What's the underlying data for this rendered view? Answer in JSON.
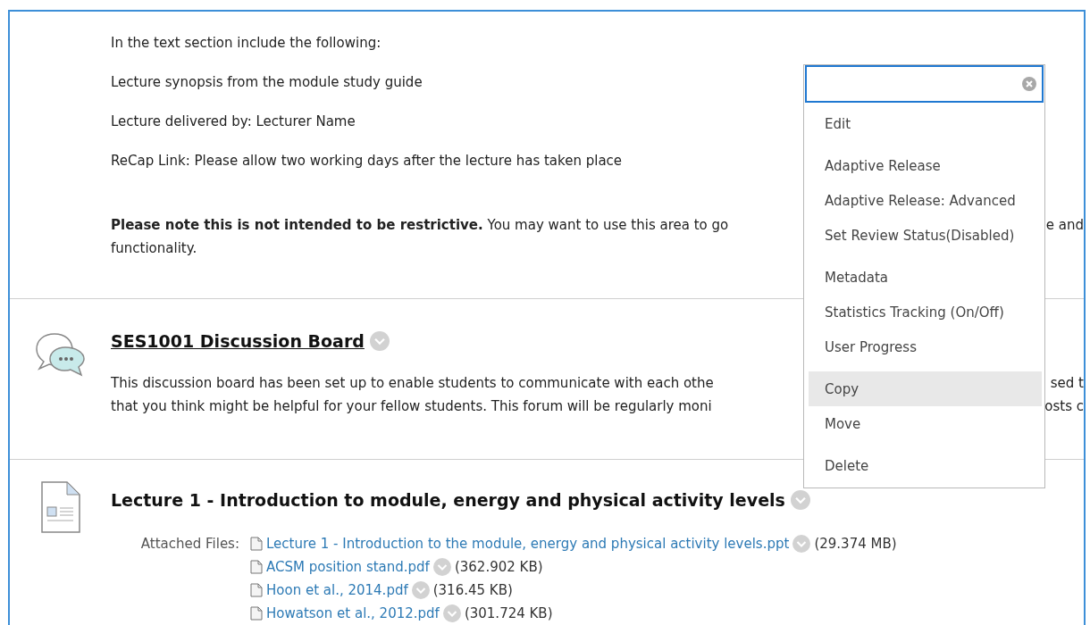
{
  "intro": {
    "lines": [
      "In the text section include the following:",
      "Lecture synopsis from the module study guide",
      "Lecture delivered by: Lecturer Name",
      "ReCap Link: Please allow two working days after the lecture has taken place"
    ],
    "note": {
      "left": "**Please note this is not intended to be restrictive.** You may want to use this area to go",
      "right": "e and",
      "continuation": "functionality."
    }
  },
  "discussion": {
    "title": "SES1001 Discussion Board",
    "lines": [
      {
        "left": "This discussion board has been set up to enable students to communicate with each othe",
        "right": "sed t"
      },
      {
        "left": "that you think might be helpful for your fellow students. This forum will be regularly moni",
        "right": "osts c"
      }
    ]
  },
  "lecture": {
    "title": "Lecture 1 - Introduction to module, energy and physical activity levels",
    "attached_label": "Attached Files:",
    "files": [
      {
        "name": "Lecture 1 - Introduction to the module, energy and physical activity levels.ppt",
        "size": "(29.374 MB)"
      },
      {
        "name": "ACSM position stand.pdf",
        "size": "(362.902 KB)"
      },
      {
        "name": "Hoon et al., 2014.pdf",
        "size": "(316.45 KB)"
      },
      {
        "name": "Howatson et al., 2012.pdf",
        "size": "(301.724 KB)"
      }
    ]
  },
  "menu": {
    "groups": [
      [
        {
          "label": "Edit",
          "selected": false
        }
      ],
      [
        {
          "label": "Adaptive Release",
          "selected": false
        },
        {
          "label": "Adaptive Release: Advanced",
          "selected": false
        },
        {
          "label": "Set Review Status(Disabled)",
          "selected": false
        }
      ],
      [
        {
          "label": "Metadata",
          "selected": false
        },
        {
          "label": "Statistics Tracking (On/Off)",
          "selected": false
        },
        {
          "label": "User Progress",
          "selected": false
        }
      ],
      [
        {
          "label": "Copy",
          "selected": true
        },
        {
          "label": "Move",
          "selected": false
        }
      ],
      [
        {
          "label": "Delete",
          "selected": false
        }
      ]
    ]
  }
}
